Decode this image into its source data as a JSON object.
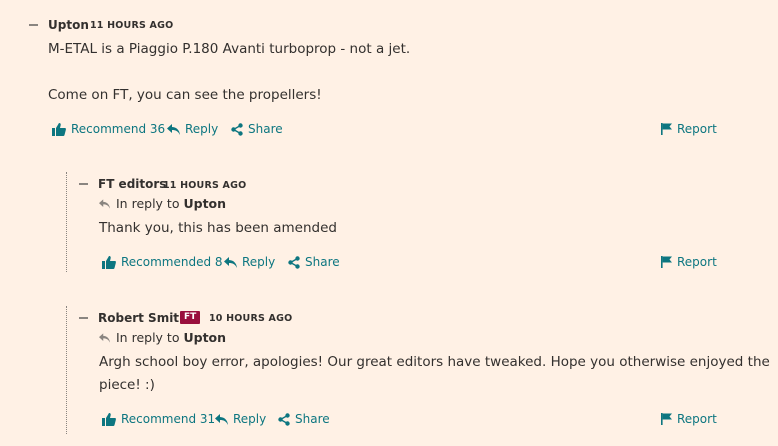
{
  "comments": [
    {
      "author": "Upton",
      "time": "11 HOURS AGO",
      "body": [
        "M-ETAL is a Piaggio P.180 Avanti turboprop - not a jet.",
        "Come on FT, you can see the propellers!"
      ],
      "recommend": "Recommend 36",
      "reply": "Reply",
      "share": "Share",
      "report": "Report"
    },
    {
      "author": "FT editors",
      "time": "11 HOURS AGO",
      "in_reply_prefix": "In reply to",
      "in_reply_name": "Upton",
      "body": [
        "Thank you, this has been amended"
      ],
      "recommend": "Recommended 8",
      "reply": "Reply",
      "share": "Share",
      "report": "Report"
    },
    {
      "author": "Robert Smith",
      "badge": "FT",
      "time": "10 HOURS AGO",
      "in_reply_prefix": "In reply to",
      "in_reply_name": "Upton",
      "body": [
        "Argh school boy error, apologies! Our great editors have tweaked. Hope you otherwise enjoyed the",
        "piece! :)"
      ],
      "recommend": "Recommend 31",
      "reply": "Reply",
      "share": "Share",
      "report": "Report"
    }
  ],
  "colors": {
    "background": "#fff1e5",
    "link": "#0d7680",
    "text": "#33302e",
    "badge": "#990f3d"
  }
}
